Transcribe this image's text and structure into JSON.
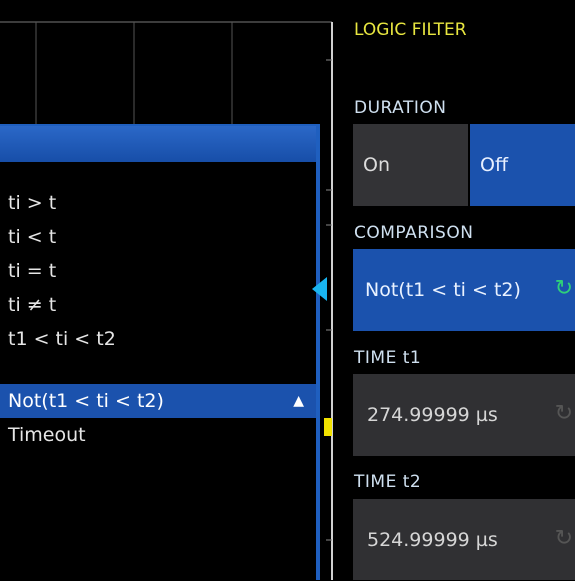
{
  "popup": {
    "items": [
      "ti > t",
      "ti < t",
      "ti = t",
      "ti ≠ t",
      "t1 < ti < t2",
      "Not(t1 < ti < t2)",
      "Timeout"
    ],
    "selected_index": 5
  },
  "panel": {
    "title": "LOGIC FILTER",
    "duration": {
      "label": "DURATION",
      "on": "On",
      "off": "Off",
      "active": "Off"
    },
    "comparison": {
      "label": "COMPARISON",
      "value": "Not(t1 < ti < t2)"
    },
    "time_t1": {
      "label": "TIME t1",
      "value": "274.99999 µs"
    },
    "time_t2": {
      "label": "TIME t2",
      "value": "524.99999 µs"
    }
  },
  "colors": {
    "accent_blue": "#1b52ad",
    "title_yellow": "#e8e640",
    "arrow_cyan": "#19b4f0",
    "inactive_box": "#303033"
  },
  "icons": {
    "spin_active": "rotate-arrow-icon",
    "spin_inactive": "rotate-arrow-icon",
    "selection_arrows": "up-down-arrows-icon"
  }
}
